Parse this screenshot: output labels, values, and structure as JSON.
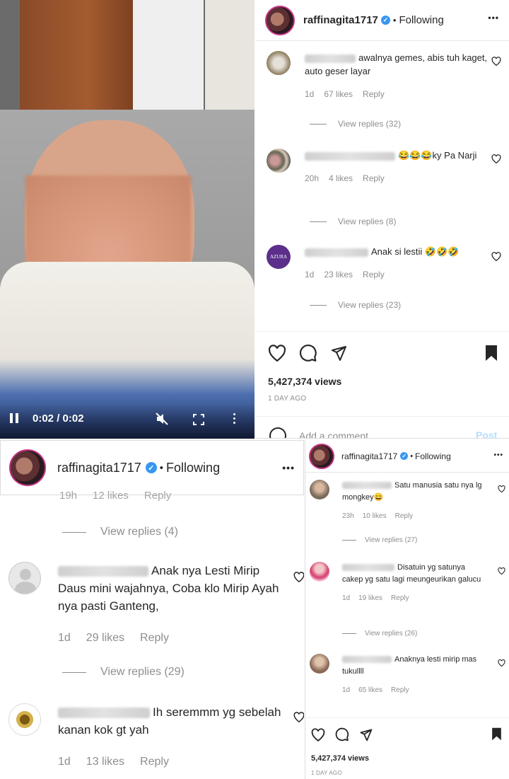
{
  "username": "raffinagita1717",
  "follow_label": "Following",
  "more_label": "•••",
  "dot": "•",
  "video": {
    "time": "0:02 / 0:02"
  },
  "views": "5,427,374 views",
  "posted": "1 DAY AGO",
  "add_comment_placeholder": "Add a comment...",
  "post_label": "Post",
  "panel1": {
    "comments": [
      {
        "text": "awalnya gemes, abis tuh kaget, auto geser layar",
        "time": "1d",
        "likes": "67 likes",
        "reply": "Reply",
        "view_replies": "View replies (32)"
      },
      {
        "text": "😂😂😂ky Pa Narji",
        "time": "20h",
        "likes": "4 likes",
        "reply": "Reply",
        "view_replies": "View replies (8)"
      },
      {
        "text": "Anak si lestii 🤣🤣🤣",
        "time": "1d",
        "likes": "23 likes",
        "reply": "Reply",
        "view_replies": "View replies (23)",
        "avatar_text": "AZURA"
      }
    ]
  },
  "panel2": {
    "partial_meta": {
      "time": "19h",
      "likes": "12 likes",
      "reply": "Reply"
    },
    "view_replies_top": "View replies (4)",
    "comments": [
      {
        "text": "Anak nya Lesti Mirip Daus mini wajahnya, Coba klo Mirip Ayah nya pasti Ganteng,",
        "time": "1d",
        "likes": "29 likes",
        "reply": "Reply",
        "view_replies": "View replies (29)"
      },
      {
        "text": "Ih seremmm yg sebelah kanan kok gt yah",
        "time": "1d",
        "likes": "13 likes",
        "reply": "Reply"
      }
    ]
  },
  "panel3": {
    "comments": [
      {
        "text": "Satu manusia satu nya lg mongkey😄",
        "time": "23h",
        "likes": "10 likes",
        "reply": "Reply",
        "view_replies": "View replies (27)"
      },
      {
        "text": "Disatuin yg satunya cakep yg satu lagi meungeurikan galucu",
        "time": "1d",
        "likes": "19 likes",
        "reply": "Reply",
        "view_replies": "View replies (26)"
      },
      {
        "text": "Anaknya lesti mirip mas tukullll",
        "time": "1d",
        "likes": "65 likes",
        "reply": "Reply"
      }
    ]
  }
}
